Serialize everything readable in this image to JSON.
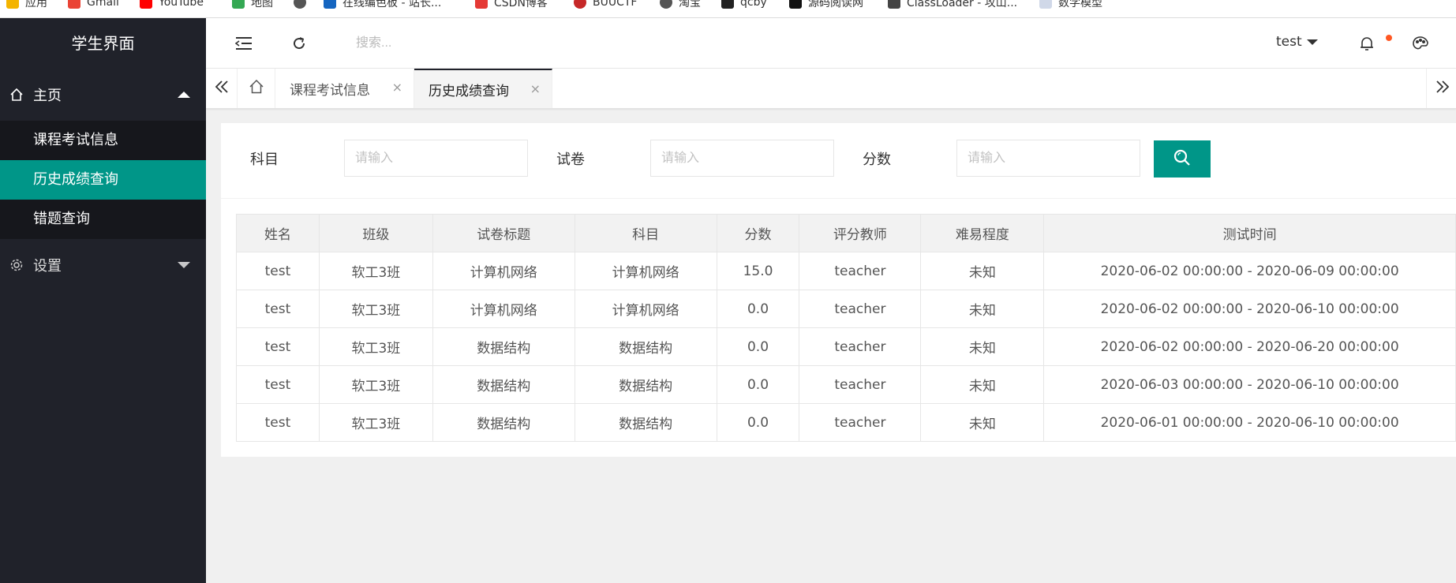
{
  "bookmarks": [
    {
      "label": "应用",
      "color": "#f4b400"
    },
    {
      "label": "Gmail",
      "color": "#ea4335"
    },
    {
      "label": "YouTube",
      "color": "#ff0000"
    },
    {
      "label": "地图",
      "color": "#34a853"
    },
    {
      "label": "",
      "color": "#555555"
    },
    {
      "label": "在线编色板 - 站长...",
      "color": "#1565c0"
    },
    {
      "label": "CSDN博客",
      "color": "#e53935"
    },
    {
      "label": "BUUCTF",
      "color": "#c62828"
    },
    {
      "label": "淘宝",
      "color": "#555555"
    },
    {
      "label": "qcby",
      "color": "#222222"
    },
    {
      "label": "源码阅读网",
      "color": "#111111"
    },
    {
      "label": "ClassLoader - 攻山...",
      "color": "#444444"
    },
    {
      "label": "数学模型",
      "color": "#d0d8e8"
    }
  ],
  "sidebar": {
    "logo": "学生界面",
    "home": {
      "label": "主页",
      "icon": "home-icon"
    },
    "sub_items": [
      "课程考试信息",
      "历史成绩查询",
      "错题查询"
    ],
    "active_index": 1,
    "settings": {
      "label": "设置",
      "icon": "gear-icon"
    }
  },
  "header": {
    "search_placeholder": "搜索...",
    "user": "test",
    "icons": [
      "menu-fold-icon",
      "refresh-icon",
      "bell-icon",
      "palette-icon"
    ]
  },
  "tabs": {
    "items": [
      {
        "label": "课程考试信息",
        "active": false
      },
      {
        "label": "历史成绩查询",
        "active": true
      }
    ],
    "close_glyph": "×"
  },
  "form": {
    "fields": [
      {
        "label": "科目",
        "placeholder": "请输入"
      },
      {
        "label": "试卷",
        "placeholder": "请输入"
      },
      {
        "label": "分数",
        "placeholder": "请输入"
      }
    ]
  },
  "table": {
    "headers": [
      "姓名",
      "班级",
      "试卷标题",
      "科目",
      "分数",
      "评分教师",
      "难易程度",
      "测试时间"
    ],
    "rows": [
      [
        "test",
        "软工3班",
        "计算机网络",
        "计算机网络",
        "15.0",
        "teacher",
        "未知",
        "2020-06-02 00:00:00 - 2020-06-09 00:00:00"
      ],
      [
        "test",
        "软工3班",
        "计算机网络",
        "计算机网络",
        "0.0",
        "teacher",
        "未知",
        "2020-06-02 00:00:00 - 2020-06-10 00:00:00"
      ],
      [
        "test",
        "软工3班",
        "数据结构",
        "数据结构",
        "0.0",
        "teacher",
        "未知",
        "2020-06-02 00:00:00 - 2020-06-20 00:00:00"
      ],
      [
        "test",
        "软工3班",
        "数据结构",
        "数据结构",
        "0.0",
        "teacher",
        "未知",
        "2020-06-03 00:00:00 - 2020-06-10 00:00:00"
      ],
      [
        "test",
        "软工3班",
        "数据结构",
        "数据结构",
        "0.0",
        "teacher",
        "未知",
        "2020-06-01 00:00:00 - 2020-06-10 00:00:00"
      ]
    ]
  },
  "colors": {
    "accent": "#009688",
    "sidebar": "#20222a",
    "notify_dot": "#ff5722"
  }
}
